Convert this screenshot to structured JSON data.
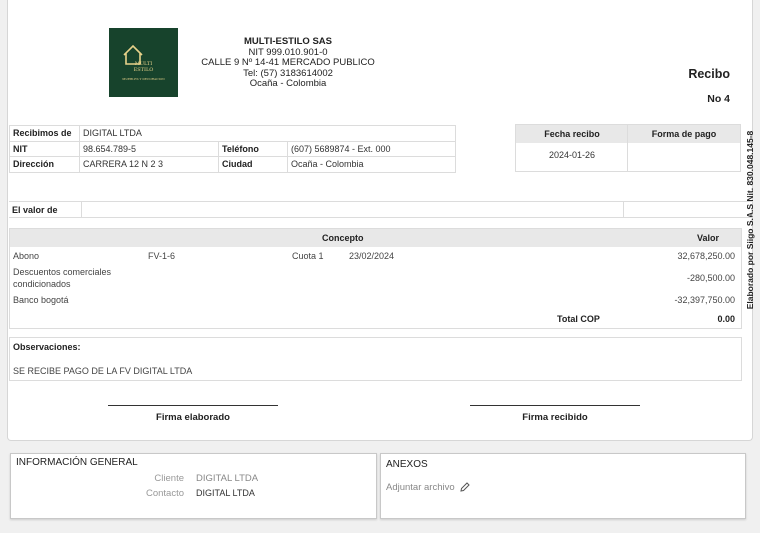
{
  "company": {
    "logo_text": [
      "MULTI",
      "ESTILO",
      "MUEBLES Y DECORACION"
    ],
    "name": "MULTI-ESTILO SAS",
    "nit": "NIT 999.010.901-0",
    "address": "CALLE 9 Nº 14-41 MERCADO PUBLICO",
    "phone": "Tel: (57) 3183614002",
    "city": "Ocaña - Colombia"
  },
  "receipt": {
    "title": "Recibo",
    "number": "No 4"
  },
  "vertical_note": "Elaborado por Siigo S.A.S Nit. 830.048.145-8",
  "client": {
    "received_from_label": "Recibimos de",
    "received_from": "DIGITAL LTDA",
    "nit_label": "NIT",
    "nit": "98.654.789-5",
    "phone_label": "Teléfono",
    "phone": "(607) 5689874 - Ext. 000",
    "address_label": "Dirección",
    "address": "CARRERA 12 N 2 3",
    "city_label": "Ciudad",
    "city": "Ocaña - Colombia"
  },
  "date_box": {
    "date_label": "Fecha recibo",
    "payment_label": "Forma de pago",
    "date": "2024-01-26",
    "payment": ""
  },
  "amount_in_words": {
    "label": "El valor de",
    "value": ""
  },
  "concepts": {
    "header_concept": "Concepto",
    "header_value": "Valor",
    "rows": [
      {
        "name": "Abono",
        "doc": "FV-1-6",
        "installment": "Cuota 1",
        "date": "23/02/2024",
        "value": "32,678,250.00"
      },
      {
        "name": "Descuentos comerciales",
        "name2": "condicionados",
        "value": "-280,500.00"
      },
      {
        "name": "Banco bogotá",
        "value": "-32,397,750.00"
      }
    ],
    "total_label": "Total COP",
    "total": "0.00"
  },
  "observations": {
    "label": "Observaciones:",
    "text": "SE RECIBE PAGO DE LA FV DIGITAL LTDA"
  },
  "signatures": {
    "left": "Firma elaborado",
    "right": "Firma recibido"
  },
  "general_info": {
    "title": "INFORMACIÓN GENERAL",
    "client_label": "Cliente",
    "client": "DIGITAL LTDA",
    "contact_label": "Contacto",
    "contact": "DIGITAL LTDA"
  },
  "annexes": {
    "title": "ANEXOS",
    "attach_label": "Adjuntar archivo"
  },
  "colors": {
    "logo_bg": "#17432c",
    "logo_gold": "#e7d28a",
    "header_gray": "#e8e8e8"
  }
}
